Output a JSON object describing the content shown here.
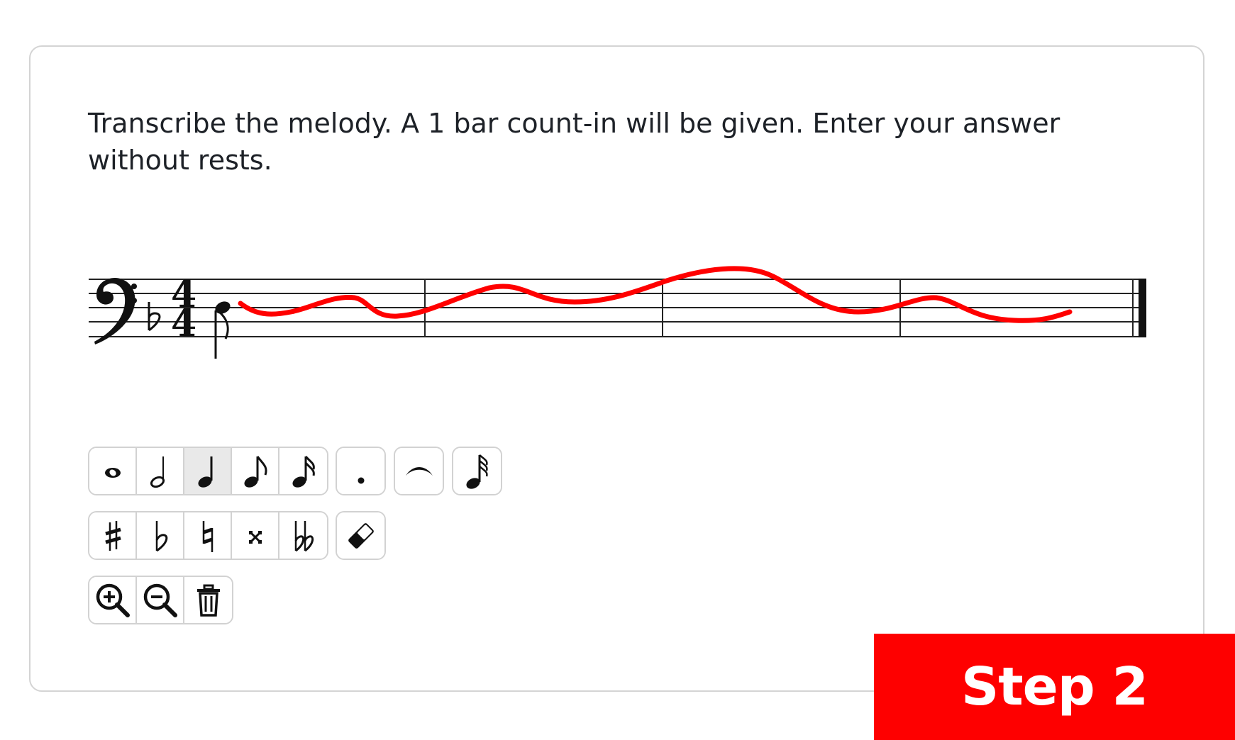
{
  "question": {
    "text": "Transcribe the melody. A 1 bar count-in will be given. Enter your answer without rests."
  },
  "score": {
    "clef": "bass-clef",
    "key_signature": "1 flat",
    "time_signature": {
      "top": "4",
      "bottom": "4"
    },
    "measures": 4,
    "entered_notes": [
      {
        "duration": "eighth",
        "pitch": "D3"
      }
    ],
    "annotation_color": "#ff0000"
  },
  "toolbar": {
    "durations": [
      {
        "name": "whole-note-icon",
        "selected": false
      },
      {
        "name": "half-note-icon",
        "selected": false
      },
      {
        "name": "quarter-note-icon",
        "selected": true
      },
      {
        "name": "eighth-note-icon",
        "selected": false
      },
      {
        "name": "sixteenth-note-icon",
        "selected": false
      }
    ],
    "modifiers": [
      "dot-icon",
      "tie-icon",
      "thirty-second-note-icon"
    ],
    "accidentals": [
      "sharp-icon",
      "flat-icon",
      "natural-icon",
      "double-sharp-icon",
      "double-flat-icon"
    ],
    "eraser": "eraser-icon",
    "view": [
      "zoom-in-icon",
      "zoom-out-icon",
      "trash-icon"
    ],
    "selected_color": "#e9e9e9"
  },
  "badge": {
    "label": "Step 2",
    "color": "#fe0000"
  }
}
